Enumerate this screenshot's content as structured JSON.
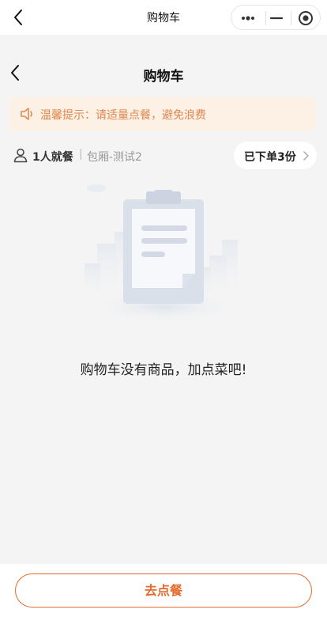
{
  "system_bar": {
    "title": "购物车",
    "icons": [
      "back-icon",
      "more-dots-icon",
      "minimize-icon",
      "close-target-icon"
    ]
  },
  "header": {
    "title": "购物车"
  },
  "notice": {
    "text": "温馨提示：请适量点餐，避免浪费",
    "icon": "speaker-icon"
  },
  "diner_info": {
    "diners": "1人就餐",
    "separator": "|",
    "room": "包厢-测试2",
    "ordered_label": "已下单3份"
  },
  "empty_state": {
    "message": "购物车没有商品，加点菜吧!",
    "illustration": "empty-clipboard-icon"
  },
  "footer": {
    "go_order_label": "去点餐"
  },
  "colors": {
    "accent": "#e46b2c",
    "notice_bg": "#fdf0e4",
    "notice_text": "#e0874f",
    "page_bg": "#f4f4f4"
  }
}
